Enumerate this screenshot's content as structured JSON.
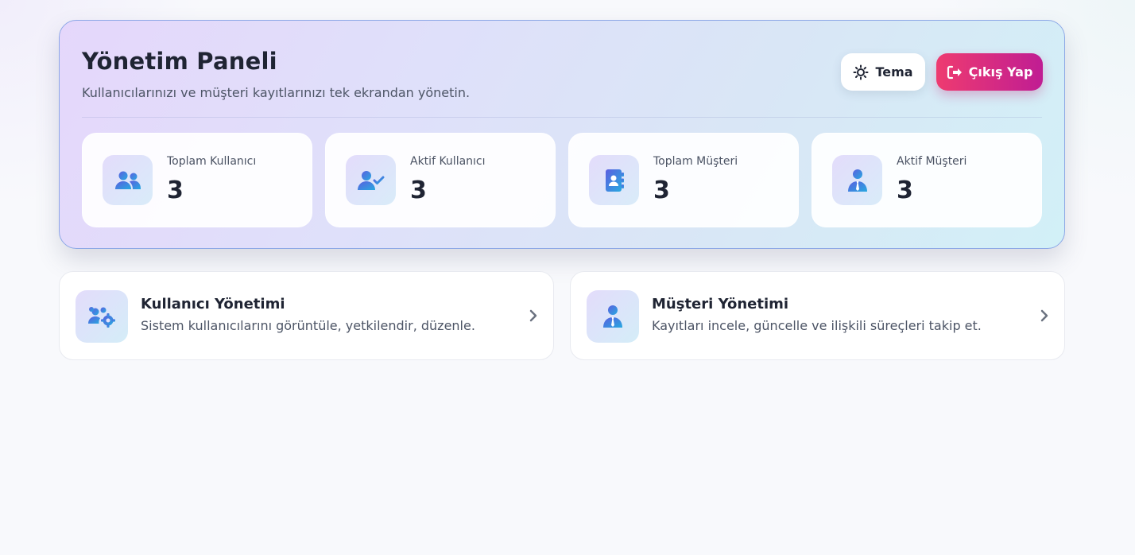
{
  "header": {
    "title": "Yönetim Paneli",
    "subtitle": "Kullanıcılarınızı ve müşteri kayıtlarınızı tek ekrandan yönetin.",
    "theme_button": "Tema",
    "logout_button": "Çıkış Yap"
  },
  "stats": [
    {
      "label": "Toplam Kullanıcı",
      "value": "3",
      "icon": "users-icon"
    },
    {
      "label": "Aktif Kullanıcı",
      "value": "3",
      "icon": "user-check-icon"
    },
    {
      "label": "Toplam Müşteri",
      "value": "3",
      "icon": "address-book-icon"
    },
    {
      "label": "Aktif Müşteri",
      "value": "3",
      "icon": "user-tie-icon"
    }
  ],
  "cards": [
    {
      "title": "Kullanıcı Yönetimi",
      "description": "Sistem kullanıcılarını görüntüle, yetkilendir, düzenle.",
      "icon": "users-gear-icon"
    },
    {
      "title": "Müşteri Yönetimi",
      "description": "Kayıtları incele, güncelle ve ilişkili süreçleri takip et.",
      "icon": "user-tie-icon"
    }
  ],
  "colors": {
    "accent_start": "#5b5fe0",
    "accent_end": "#27a9e0",
    "logout_start": "#ee3b70",
    "logout_end": "#c01d93"
  }
}
